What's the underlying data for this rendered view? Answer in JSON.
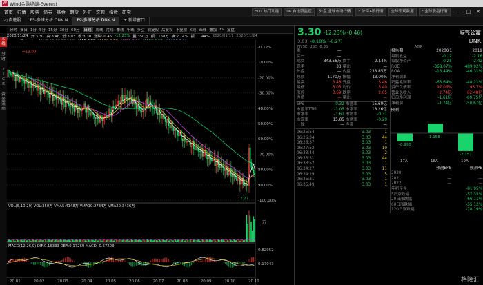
{
  "titlebar": {
    "logo": "W",
    "title": "Wind金融终端-Everest"
  },
  "menubar": {
    "items": [
      "首页",
      "行情",
      "股票",
      "债券",
      "基金",
      "期货",
      "外汇",
      "宏观",
      "指数",
      "研究"
    ],
    "hot": [
      "HOT 热门功能",
      "06 自选股监控",
      "外盘 全球市场行情",
      "F 沪深A股行情",
      "全球宏观数据",
      "F 全球股指行情"
    ],
    "controls": [
      "—",
      "□",
      "✕"
    ]
  },
  "tabs": [
    "◁ 自选股",
    "F5-多维分析 DNK.N",
    "F9-多维分析 DNK.N",
    "+ 新增窗口"
  ],
  "toolbar": [
    "分时",
    "多日",
    "1分",
    "5分",
    "15分",
    "30分",
    "60分",
    "日线",
    "周线",
    "月线",
    "季线",
    "年线",
    "多空",
    "前复权",
    "后复权",
    "不复权",
    "K线",
    "画线",
    "叠加",
    "F9",
    "复盘"
  ],
  "toolbar_active_index": 7,
  "leftstrip": [
    "K",
    "线",
    "分",
    "时",
    "T",
    "I",
    "C",
    "K",
    "资",
    "金",
    "流",
    "向"
  ],
  "chart_info": {
    "line1": [
      "2020/11/24",
      "开:3.30",
      "高:3.46",
      "低:3.03",
      "收:3.30",
      "涨跌:-0.46",
      "-12.23%",
      "量:350万",
      "额:1168万",
      "换:2.14%",
      "振:11.44%"
    ],
    "dates": [
      "2020/01/17",
      "2020/11/24"
    ],
    "line2": {
      "ticker": "DNKN [蛋壳公寓]",
      "ma_label": "MA(5,10,20,60,120)",
      "ma5": "MA5.3.80",
      "ma10": "MA10.2.77",
      "ma20": "MA20.2.21",
      "ma60": "MA60.3.68",
      "ma120": "MA120.6.11"
    }
  },
  "chart_axis": {
    "price_ticks": [
      "-0.12%",
      "10.00%",
      "-20.00%",
      "-30.00%",
      "40.00%",
      "50.00%",
      "60.00%",
      "-70.00%",
      "80.00%",
      "90.00%",
      "-100.00%"
    ],
    "high_label": "13.00",
    "low_label": "2.27",
    "x_ticks": [
      "20.01",
      "20.02",
      "20.03",
      "20.04",
      "20.05",
      "20.06",
      "20.07",
      "20.08",
      "20.09",
      "20.10",
      "20.11"
    ],
    "vol_label": "VOL(5,10,20) VOL:350万 VMA5:4148万 VMA10:2734万 VMA20:3436万",
    "vol_axis": "万",
    "macd_label": "MACD(12,26,9) DIF:0.16333 DEA:0.17269 MACD:-0.67203",
    "macd_ticks": [
      "0.82952",
      "0.17043"
    ]
  },
  "quote": {
    "price": "3.30",
    "change": "-12.23%(-0.46)",
    "name": "蛋壳公寓",
    "ticker": "DNK",
    "sub_price": "3.03",
    "sub_change": "-8.18% (-0.27)",
    "exchange": "NYSE",
    "usd": "USD",
    "pre": "6.35",
    "adr": "ADR"
  },
  "quote_table": [
    [
      "卖一",
      "—",
      ""
    ],
    [
      "买一",
      "—",
      ""
    ],
    [
      "成交",
      "343.56万",
      "换手",
      "2.14%"
    ],
    [
      "现手",
      "30",
      "量比",
      "—"
    ],
    [
      "外盘",
      "—",
      "内盘",
      "238.85万"
    ],
    [
      "总额",
      "1170万",
      "振幅",
      "13.00%"
    ],
    [
      "最高",
      "3.48",
      "开盘",
      "3.46"
    ],
    [
      "最低",
      "3.03",
      "均价",
      "3.40"
    ],
    [
      "涨停",
      "3.69",
      "跌停",
      "2.65"
    ],
    [
      "净值",
      "—",
      "量比",
      "—"
    ]
  ],
  "quote_table2": [
    [
      "EPS",
      "-0.32",
      "市盈率",
      "15.60亿"
    ],
    [
      "市盈率TTM",
      "-1.05",
      "市净率",
      "18.26亿"
    ],
    [
      "市净率",
      "-1.61",
      "市销率",
      "-0.31"
    ],
    [
      "市现率",
      "15.05",
      "市净率",
      "-0.29"
    ],
    [
      "一致",
      "—",
      "净资",
      "—"
    ]
  ],
  "finance_header": [
    "报告期",
    "2020Q1",
    "2019"
  ],
  "finance": [
    [
      "每股收益",
      "-0.12",
      "-2.16"
    ],
    [
      "每股净资产",
      "-0.25",
      "-2.42"
    ],
    [
      "ROE",
      "-368.07%",
      "-489.92%"
    ],
    [
      "ROA",
      "-13.44%",
      "-46.31%"
    ],
    [
      "净利润率",
      "—",
      "—"
    ],
    [
      "销售毛利率",
      "-63.64%",
      "-48.21%"
    ],
    [
      "资产负债率",
      "97.06%",
      "95.7%"
    ],
    [
      "营业总收入",
      "2.74亿",
      "62.48亿"
    ],
    [
      "归母净利润",
      "-1.61亿",
      "-69.75亿"
    ],
    [
      "净利润",
      "-1.74亿",
      "-50.67亿"
    ]
  ],
  "mini_chart": {
    "label": "预测",
    "values": [
      -0.99,
      1.158,
      -2.157
    ],
    "value_labels": [
      "-0.990",
      "1.158",
      "-2.157"
    ],
    "years": [
      "17A",
      "18A",
      "19A"
    ]
  },
  "trades_header": [
    "时间",
    "价格",
    "量"
  ],
  "trades": [
    [
      "06:25:54",
      "3.03",
      "1"
    ],
    [
      "06:26:34",
      "3.03",
      "44"
    ],
    [
      "06:26:37",
      "3.03",
      "1"
    ],
    [
      "06:27:52",
      "3.03",
      "10"
    ],
    [
      "06:33:44",
      "3.03",
      "2"
    ],
    [
      "06:33:51",
      "3.03",
      "44"
    ],
    [
      "06:33:52",
      "3.03",
      "1"
    ],
    [
      "06:34:27",
      "3.03",
      "11"
    ],
    [
      "06:34:29",
      "3.03",
      "5"
    ],
    [
      "06:35:31",
      "3.03",
      "1"
    ],
    [
      "06:35:49",
      "3.03",
      "1"
    ]
  ],
  "forecast": {
    "header": [
      "预测EPS",
      "预测PE"
    ],
    "rows": [
      [
        "2020",
        "—",
        "—"
      ],
      [
        "2021",
        "—",
        "—"
      ],
      [
        "2022",
        "—",
        "—"
      ]
    ]
  },
  "stats": [
    [
      "年初至今",
      "-81.95%"
    ],
    [
      "5日涨跌幅",
      "-57.35%"
    ],
    [
      "20日涨跌幅",
      "-66.11%"
    ],
    [
      "60日涨跌幅",
      "-55.12%"
    ],
    [
      "120日涨跌幅",
      "-78.19%"
    ]
  ],
  "watermark": "格隆汇",
  "colors": {
    "up": "#ff4040",
    "down": "#19d46a",
    "ma5": "#ffffff",
    "ma10": "#f0c419",
    "ma20": "#e040fb",
    "ma60": "#00e676",
    "ma120": "#4fc3f7"
  }
}
